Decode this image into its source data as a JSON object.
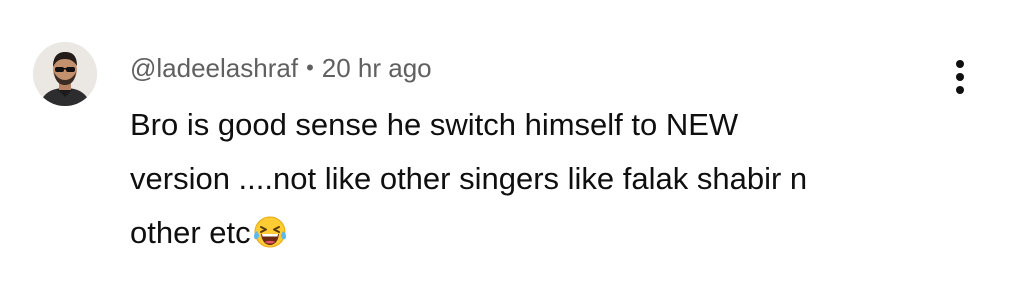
{
  "comment": {
    "author": "@ladeelashraf",
    "separator": "•",
    "time": "20 hr ago",
    "text_lines": [
      "Bro is good sense he switch himself to NEW",
      "version ....not like other singers like falak shabir n",
      "other etc"
    ],
    "trailing_emoji": "laughing-with-tears-emoji",
    "avatar_icon": "avatar-photo",
    "menu_icon": "more-vertical-icon"
  },
  "colors": {
    "text": "#0f0f0f",
    "meta_text": "#606060",
    "background": "#ffffff"
  }
}
